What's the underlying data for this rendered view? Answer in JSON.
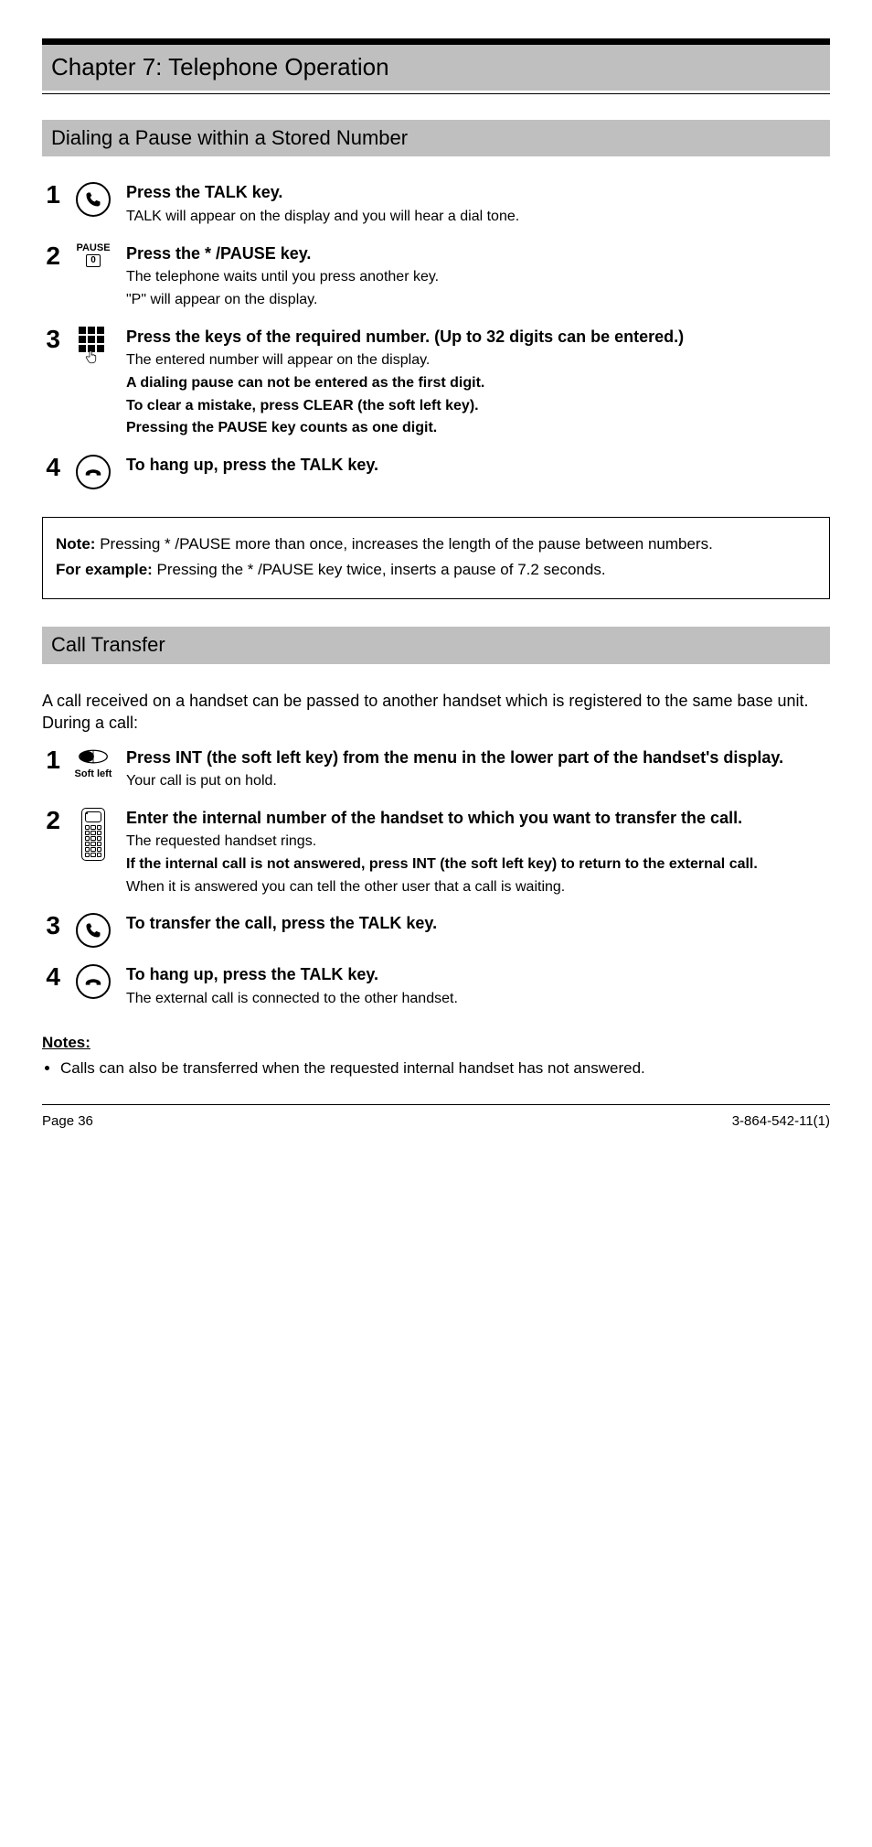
{
  "chapter": {
    "title": "Chapter 7:  Telephone Operation",
    "hr_present": true
  },
  "section1": {
    "title": "Dialing a Pause within a Stored Number",
    "steps": [
      {
        "num": "1",
        "icon": "talk",
        "lead": "Press the TALK key.",
        "subs": [
          "TALK will appear on the display and you will hear a dial tone."
        ]
      },
      {
        "num": "2",
        "icon": "pause",
        "lead": "Press the * /PAUSE key.",
        "subs": [
          "The telephone waits until you press another key.",
          "\"P\" will appear on the display."
        ]
      },
      {
        "num": "3",
        "icon": "keypad",
        "lead": "Press the keys of the required number. (Up to 32 digits can be entered.)",
        "subs": [
          "The entered number will appear on the display.",
          "A dialing pause can not be entered as the first digit.",
          "To clear a mistake, press CLEAR (the soft left key).",
          "Pressing the PAUSE key counts as one digit."
        ]
      },
      {
        "num": "4",
        "icon": "hangup",
        "lead": "To hang up, press the TALK key.",
        "subs": []
      }
    ],
    "note": {
      "lead": "Note:",
      "body": "Pressing * /PAUSE more than once, increases the length of the pause between numbers.",
      "extra_lead": "For example:",
      "extra": "Pressing the * /PAUSE key twice, inserts a pause of 7.2 seconds."
    }
  },
  "section2": {
    "title": "Call Transfer",
    "intro1": "A call received on a handset can be passed to another handset which is registered to the same base unit. During a call:",
    "steps": [
      {
        "num": "1",
        "icon": "soft-left",
        "soft_label": "Soft left",
        "lead_parts": [
          "Press ",
          "INT",
          " (the soft left key) from the menu in the lower part of the handset's display."
        ],
        "subs": [
          "Your call is put on hold."
        ]
      },
      {
        "num": "2",
        "icon": "handset",
        "lead": "Enter the internal number of the handset to which you want to transfer the call.",
        "subs": [
          "The requested handset rings.",
          "If the internal call is not answered, press INT (the soft left key) to return to the external call.",
          "When it is answered you can tell the other user that a call is waiting."
        ]
      },
      {
        "num": "3",
        "icon": "talk",
        "lead": "To transfer the call, press the TALK key.",
        "subs": []
      },
      {
        "num": "4",
        "icon": "hangup",
        "lead": "To hang up, press the TALK key.",
        "subs": [
          "The external call is connected to the other handset."
        ]
      }
    ],
    "notes_heading": "Notes:",
    "notes": [
      "Calls can also be transferred when the requested internal handset has not answered."
    ]
  },
  "footer": {
    "left": "Page 36",
    "right": "3-864-542-11(1)"
  },
  "icons": {
    "pause_label_small": "PAUSE",
    "pause_key_label": "0"
  }
}
